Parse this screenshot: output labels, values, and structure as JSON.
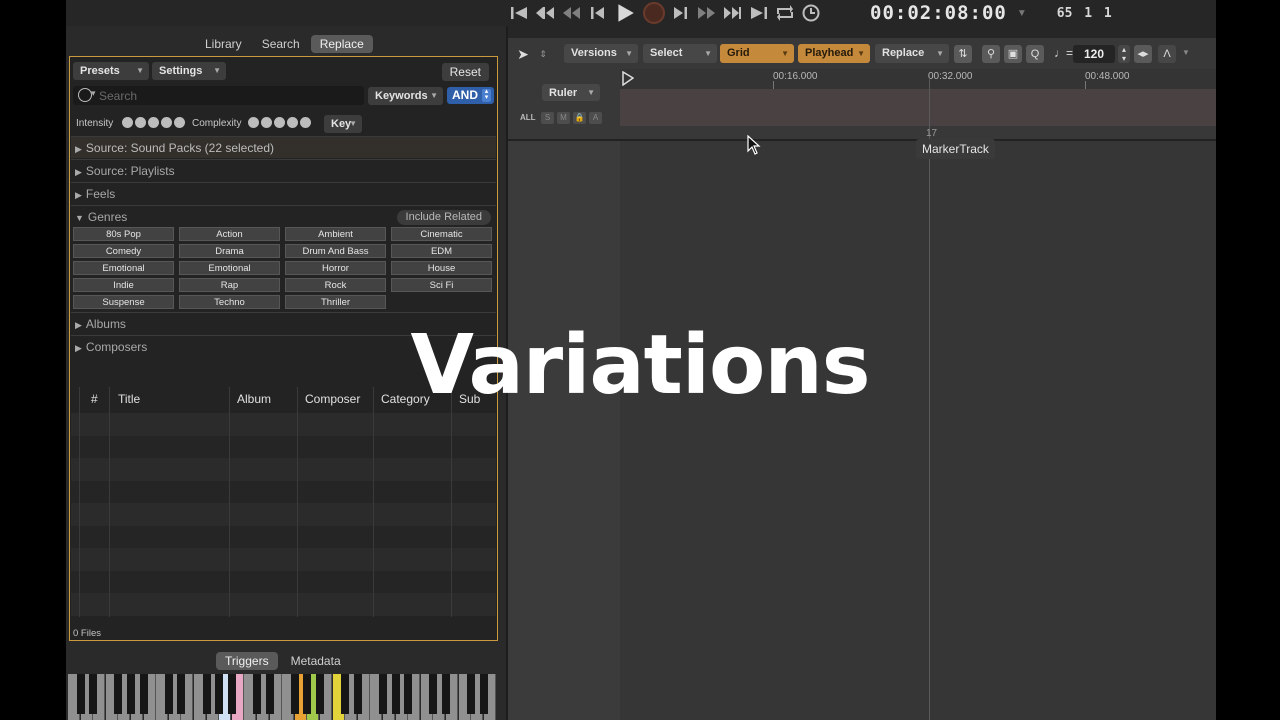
{
  "transport": {
    "timecode": "00:02:08:00",
    "bars": "65 1 1"
  },
  "left_panel": {
    "mode_tabs": [
      "Library",
      "Search",
      "Replace"
    ],
    "active_tab": "Replace",
    "presets_label": "Presets",
    "settings_label": "Settings",
    "reset_label": "Reset",
    "search_placeholder": "Search",
    "keywords_label": "Keywords",
    "and_label": "AND",
    "intensity_label": "Intensity",
    "complexity_label": "Complexity",
    "key_label": "Key",
    "sections": {
      "source_packs": "Source: Sound Packs (22 selected)",
      "source_playlists": "Source: Playlists",
      "feels": "Feels",
      "genres": "Genres",
      "albums": "Albums",
      "composers": "Composers"
    },
    "include_related_label": "Include Related",
    "genres": [
      "80s Pop",
      "Action",
      "Ambient",
      "Cinematic",
      "Comedy",
      "Drama",
      "Drum And Bass",
      "EDM",
      "Emotional",
      "Emotional",
      "Horror",
      "House",
      "Indie",
      "Rap",
      "Rock",
      "Sci Fi",
      "Suspense",
      "Techno",
      "Thriller"
    ],
    "table_columns": [
      "#",
      "Title",
      "Album",
      "Composer",
      "Category",
      "Sub Ca"
    ],
    "files_count": "0 Files",
    "bottom_tabs": [
      "Triggers",
      "Metadata"
    ],
    "active_bottom_tab": "Triggers"
  },
  "right_panel": {
    "toolbar": {
      "versions": "Versions",
      "select": "Select",
      "grid": "Grid",
      "playhead": "Playhead",
      "replace": "Replace",
      "bpm_symbol": "♩=",
      "bpm": "120"
    },
    "ruler_label": "Ruler",
    "ruler_ticks": [
      "00:16.000",
      "00:32.000",
      "00:48.000"
    ],
    "all_label": "ALL",
    "track_buttons": [
      "S",
      "M",
      "🔒",
      "A"
    ],
    "marker_number": "17",
    "marker_tooltip": "MarkerTrack"
  },
  "overlay_title": "Variations",
  "colors": {
    "accent_orange": "#c4893a",
    "selection_blue": "#2f5fa8",
    "browser_border": "#c99a3e"
  }
}
